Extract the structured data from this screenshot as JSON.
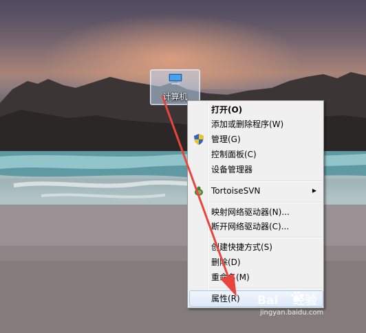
{
  "desktop": {
    "icon": {
      "label": "计算机",
      "icon_name": "computer-icon"
    }
  },
  "context_menu": {
    "items": [
      {
        "label": "打开(O)",
        "bold": true
      },
      {
        "label": "添加或删除程序(W)"
      },
      {
        "label": "管理(G)",
        "icon_name": "uac-shield-icon"
      },
      {
        "label": "控制面板(C)"
      },
      {
        "label": "设备管理器"
      },
      {
        "label": "TortoiseSVN",
        "icon_name": "tortoisesvn-icon",
        "submenu": true,
        "submenu_arrow": "▶"
      },
      {
        "label": "映射网络驱动器(N)..."
      },
      {
        "label": "断开网络驱动器(C)..."
      },
      {
        "label": "创建快捷方式(S)"
      },
      {
        "label": "删除(D)"
      },
      {
        "label": "重命名(M)"
      },
      {
        "label": "属性(R)",
        "highlighted": true
      }
    ]
  },
  "annotation": {
    "color": "#e8463c",
    "description_icon": "red-arrow"
  },
  "watermark": {
    "brand_left": "Bai",
    "brand_right": "经验",
    "url": "jingyan.baidu.com",
    "icon_name": "baidu-paw-logo"
  }
}
